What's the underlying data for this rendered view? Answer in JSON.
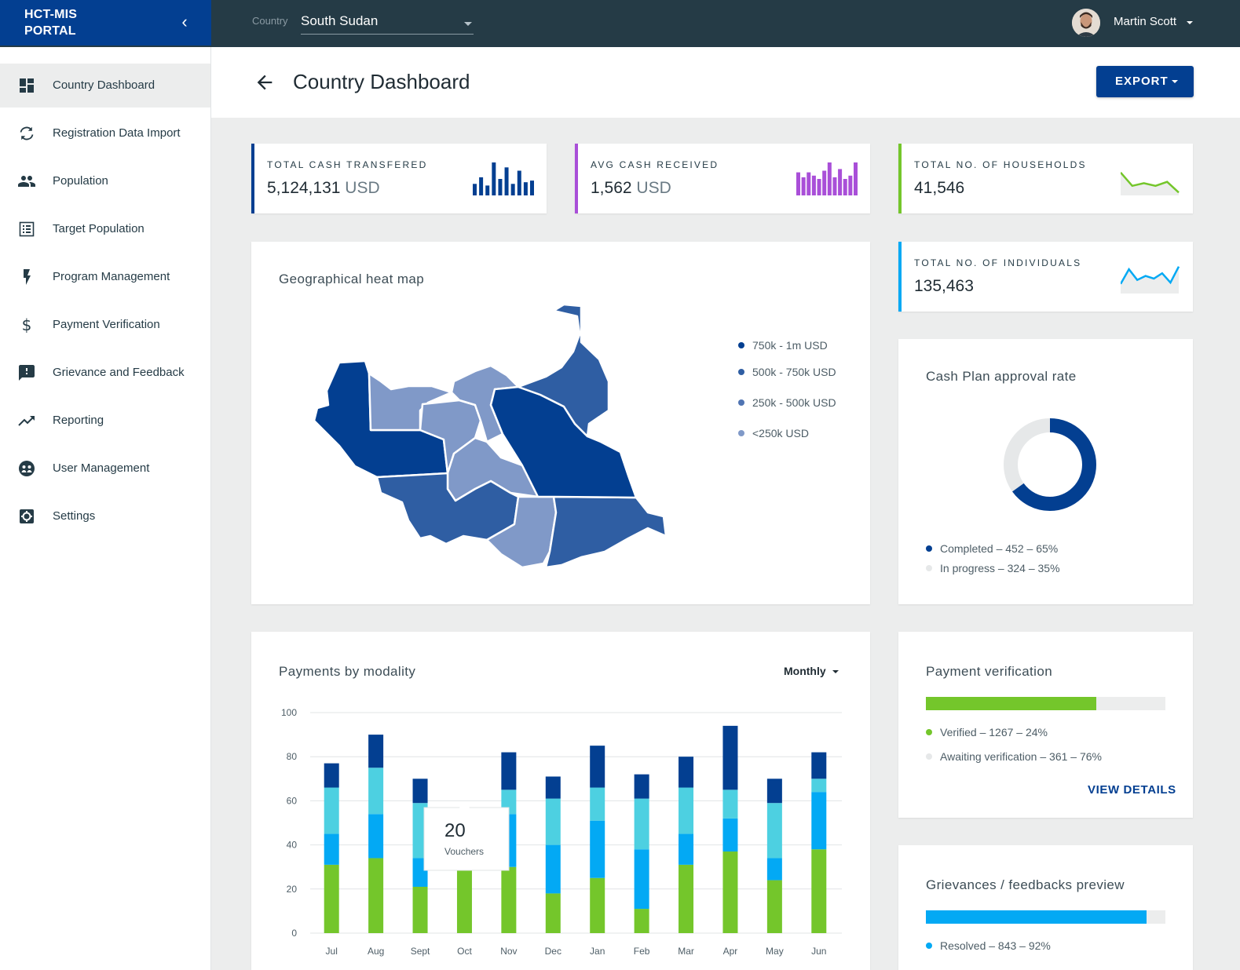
{
  "app": {
    "brand": "HCT-MIS\nPORTAL",
    "collapse_icon": "chevron-left-icon"
  },
  "topbar": {
    "country_label": "Country",
    "country_value": "South Sudan",
    "user_name": "Martin Scott"
  },
  "sidebar": {
    "items": [
      {
        "label": "Country Dashboard",
        "icon": "dashboard-icon",
        "active": true
      },
      {
        "label": "Registration Data Import",
        "icon": "sync-icon"
      },
      {
        "label": "Population",
        "icon": "people-icon"
      },
      {
        "label": "Target Population",
        "icon": "list-icon"
      },
      {
        "label": "Program Management",
        "icon": "flash-icon"
      },
      {
        "label": "Payment Verification",
        "icon": "dollar-icon"
      },
      {
        "label": "Grievance and Feedback",
        "icon": "feedback-icon"
      },
      {
        "label": "Reporting",
        "icon": "trending-up-icon"
      },
      {
        "label": "User Management",
        "icon": "group-icon"
      },
      {
        "label": "Settings",
        "icon": "settings-icon"
      }
    ]
  },
  "header": {
    "title": "Country Dashboard",
    "export_label": "EXPORT"
  },
  "stats": {
    "total_cash": {
      "label": "TOTAL CASH TRANSFERED",
      "value": "5,124,131",
      "unit": "USD",
      "color": "#033f91"
    },
    "avg_cash": {
      "label": "AVG CASH RECEIVED",
      "value": "1,562",
      "unit": "USD",
      "color": "#a94fd8"
    },
    "households": {
      "label": "TOTAL NO. OF HOUSEHOLDS",
      "value": "41,546",
      "color": "#74c62b"
    },
    "individuals": {
      "label": "TOTAL NO. OF INDIVIDUALS",
      "value": "135,463",
      "color": "#03a9f4"
    }
  },
  "heatmap": {
    "title": "Geographical heat map",
    "legend": [
      {
        "label": "750k - 1m USD",
        "color": "#033f91"
      },
      {
        "label": "500k - 750k USD",
        "color": "#2f5ea3"
      },
      {
        "label": "250k - 500k USD",
        "color": "#5074b3"
      },
      {
        "label": "<250k USD",
        "color": "#8099c8"
      }
    ]
  },
  "approval": {
    "title": "Cash Plan approval rate",
    "completed_fraction": 0.65,
    "legend": [
      {
        "label": "Completed – 452 – 65%",
        "color": "#033f91"
      },
      {
        "label": "In progress – 324 – 35%",
        "color": "#e6e8e9"
      }
    ]
  },
  "modality": {
    "title": "Payments by modality",
    "period": "Monthly",
    "tooltip": {
      "value": "20",
      "label": "Vouchers"
    }
  },
  "verification": {
    "title": "Payment verification",
    "verified_fraction": 0.71,
    "legend": [
      {
        "label": "Verified – 1267 – 24%",
        "color": "#74c62b"
      },
      {
        "label": "Awaiting verification – 361 – 76%",
        "color": "#e6e8e9"
      }
    ],
    "link": "VIEW DETAILS"
  },
  "grievances": {
    "title": "Grievances / feedbacks preview",
    "resolved_fraction": 0.92,
    "legend": [
      {
        "label": "Resolved – 843 – 92%",
        "color": "#03a9f4"
      }
    ]
  },
  "chart_data": {
    "type": "bar",
    "stacked": true,
    "categories": [
      "Jul",
      "Aug",
      "Sept",
      "Oct",
      "Nov",
      "Dec",
      "Jan",
      "Feb",
      "Mar",
      "Apr",
      "May",
      "Jun"
    ],
    "series": [
      {
        "values": [
          31,
          34,
          21,
          30,
          30,
          18,
          25,
          11,
          31,
          37,
          24,
          38
        ],
        "color": "#74c62b"
      },
      {
        "values": [
          14,
          20,
          13,
          7,
          24,
          22,
          26,
          27,
          14,
          15,
          10,
          26
        ],
        "color": "#03a9f4"
      },
      {
        "values": [
          21,
          21,
          25,
          10,
          11,
          21,
          15,
          23,
          21,
          13,
          25,
          6
        ],
        "color": "#4dd0e1"
      },
      {
        "values": [
          11,
          15,
          11,
          3,
          17,
          10,
          19,
          11,
          14,
          29,
          11,
          12
        ],
        "color": "#033f91"
      }
    ],
    "yticks": [
      0,
      20,
      40,
      60,
      80,
      100
    ],
    "ylim": [
      0,
      100
    ],
    "grid": true
  },
  "mini_charts": {
    "total_cash_bars": [
      0.35,
      0.55,
      0.3,
      1.0,
      0.5,
      0.85,
      0.35,
      0.75,
      0.4,
      0.45
    ],
    "avg_cash_bars": [
      0.7,
      0.55,
      0.7,
      0.6,
      0.5,
      0.75,
      1.0,
      0.55,
      0.8,
      0.5,
      0.6,
      1.0
    ],
    "households_line": [
      0.8,
      0.3,
      0.4,
      0.3,
      0.45,
      0.05
    ],
    "individuals_line": [
      0.3,
      0.85,
      0.45,
      0.6,
      0.5,
      0.7,
      0.35,
      0.95
    ]
  }
}
